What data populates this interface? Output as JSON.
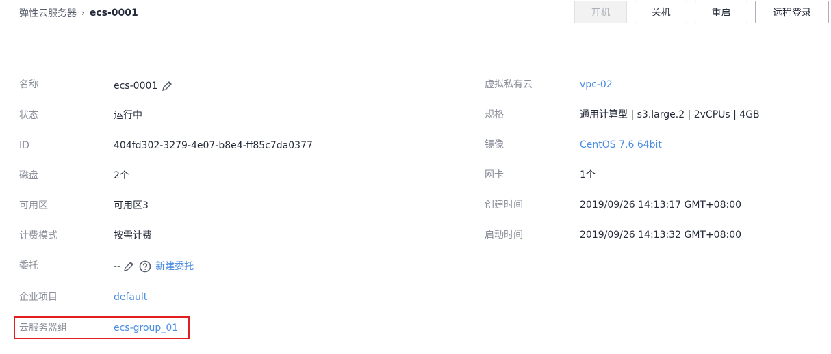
{
  "breadcrumb": {
    "parent": "弹性云服务器",
    "separator": "›",
    "current": "ecs-0001"
  },
  "toolbar": {
    "start_label": "开机",
    "stop_label": "关机",
    "restart_label": "重启",
    "remote_label": "远程登录"
  },
  "left": {
    "name_label": "名称",
    "name_value": "ecs-0001",
    "status_label": "状态",
    "status_value": "运行中",
    "id_label": "ID",
    "id_value": "404fd302-3279-4e07-b8e4-ff85c7da0377",
    "disk_label": "磁盘",
    "disk_value": "2个",
    "az_label": "可用区",
    "az_value": "可用区3",
    "billing_label": "计费模式",
    "billing_value": "按需计费",
    "agency_label": "委托",
    "agency_value": "--",
    "agency_link": "新建委托",
    "project_label": "企业项目",
    "project_value": "default",
    "group_label": "云服务器组",
    "group_value": "ecs-group_01"
  },
  "right": {
    "vpc_label": "虚拟私有云",
    "vpc_value": "vpc-02",
    "flavor_label": "规格",
    "flavor_value": "通用计算型 | s3.large.2 | 2vCPUs | 4GB",
    "image_label": "镜像",
    "image_value": "CentOS 7.6 64bit",
    "nic_label": "网卡",
    "nic_value": "1个",
    "created_label": "创建时间",
    "created_value": "2019/09/26 14:13:17 GMT+08:00",
    "launched_label": "启动时间",
    "launched_value": "2019/09/26 14:13:32 GMT+08:00"
  },
  "colors": {
    "link": "#4c8ee0",
    "label": "#8a8e99",
    "highlight": "#e02020"
  }
}
